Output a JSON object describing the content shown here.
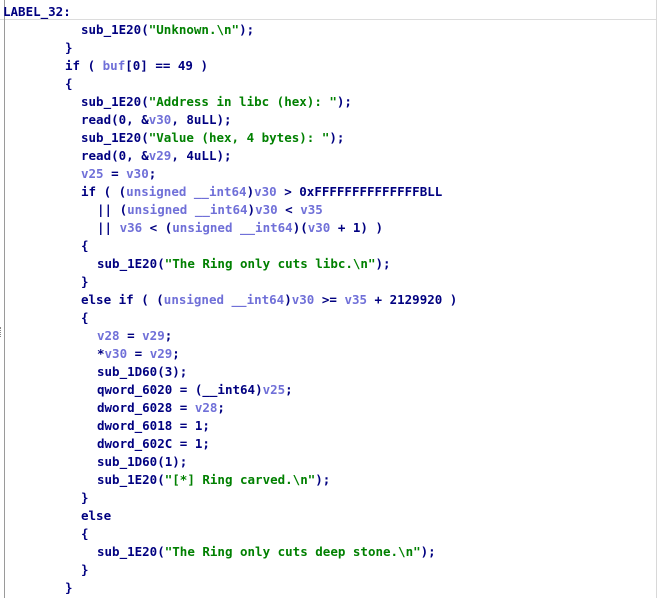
{
  "code": {
    "lines": [
      {
        "indent": 0,
        "tokens": [
          {
            "t": "LABEL_32:",
            "c": "label"
          }
        ]
      },
      {
        "indent": 2,
        "tokens": [
          {
            "t": "sub_1E20",
            "c": "func"
          },
          {
            "t": "(",
            "c": "punct"
          },
          {
            "t": "\"Unknown.\\n\"",
            "c": "str"
          },
          {
            "t": ");",
            "c": "punct"
          }
        ]
      },
      {
        "indent": 1,
        "tokens": [
          {
            "t": "}",
            "c": "punct"
          }
        ]
      },
      {
        "indent": 1,
        "tokens": [
          {
            "t": "if",
            "c": "kw"
          },
          {
            "t": " ( ",
            "c": "punct"
          },
          {
            "t": "buf",
            "c": "var"
          },
          {
            "t": "[0] == 49 )",
            "c": "punct"
          }
        ]
      },
      {
        "indent": 1,
        "tokens": [
          {
            "t": "{",
            "c": "punct"
          }
        ]
      },
      {
        "indent": 2,
        "tokens": [
          {
            "t": "sub_1E20",
            "c": "func"
          },
          {
            "t": "(",
            "c": "punct"
          },
          {
            "t": "\"Address in libc (hex): \"",
            "c": "str"
          },
          {
            "t": ");",
            "c": "punct"
          }
        ]
      },
      {
        "indent": 2,
        "tokens": [
          {
            "t": "read",
            "c": "func"
          },
          {
            "t": "(0, &",
            "c": "punct"
          },
          {
            "t": "v30",
            "c": "var"
          },
          {
            "t": ", 8uLL);",
            "c": "punct"
          }
        ]
      },
      {
        "indent": 2,
        "tokens": [
          {
            "t": "sub_1E20",
            "c": "func"
          },
          {
            "t": "(",
            "c": "punct"
          },
          {
            "t": "\"Value (hex, 4 bytes): \"",
            "c": "str"
          },
          {
            "t": ");",
            "c": "punct"
          }
        ]
      },
      {
        "indent": 2,
        "tokens": [
          {
            "t": "read",
            "c": "func"
          },
          {
            "t": "(0, &",
            "c": "punct"
          },
          {
            "t": "v29",
            "c": "var"
          },
          {
            "t": ", 4uLL);",
            "c": "punct"
          }
        ]
      },
      {
        "indent": 2,
        "tokens": [
          {
            "t": "v25",
            "c": "var"
          },
          {
            "t": " = ",
            "c": "punct"
          },
          {
            "t": "v30",
            "c": "var"
          },
          {
            "t": ";",
            "c": "punct"
          }
        ]
      },
      {
        "indent": 2,
        "tokens": [
          {
            "t": "if",
            "c": "kw"
          },
          {
            "t": " ( (",
            "c": "punct"
          },
          {
            "t": "unsigned __int64",
            "c": "type"
          },
          {
            "t": ")",
            "c": "punct"
          },
          {
            "t": "v30",
            "c": "var"
          },
          {
            "t": " > 0xFFFFFFFFFFFFFFBLL",
            "c": "punct"
          }
        ]
      },
      {
        "indent": 3,
        "tokens": [
          {
            "t": "|| (",
            "c": "punct"
          },
          {
            "t": "unsigned __int64",
            "c": "type"
          },
          {
            "t": ")",
            "c": "punct"
          },
          {
            "t": "v30",
            "c": "var"
          },
          {
            "t": " < ",
            "c": "punct"
          },
          {
            "t": "v35",
            "c": "var"
          }
        ]
      },
      {
        "indent": 3,
        "tokens": [
          {
            "t": "|| ",
            "c": "punct"
          },
          {
            "t": "v36",
            "c": "var"
          },
          {
            "t": " < (",
            "c": "punct"
          },
          {
            "t": "unsigned __int64",
            "c": "type"
          },
          {
            "t": ")(",
            "c": "punct"
          },
          {
            "t": "v30",
            "c": "var"
          },
          {
            "t": " + 1) )",
            "c": "punct"
          }
        ]
      },
      {
        "indent": 2,
        "tokens": [
          {
            "t": "{",
            "c": "punct"
          }
        ]
      },
      {
        "indent": 3,
        "tokens": [
          {
            "t": "sub_1E20",
            "c": "func"
          },
          {
            "t": "(",
            "c": "punct"
          },
          {
            "t": "\"The Ring only cuts libc.\\n\"",
            "c": "str"
          },
          {
            "t": ");",
            "c": "punct"
          }
        ]
      },
      {
        "indent": 2,
        "tokens": [
          {
            "t": "}",
            "c": "punct"
          }
        ]
      },
      {
        "indent": 2,
        "tokens": [
          {
            "t": "else if",
            "c": "kw"
          },
          {
            "t": " ( (",
            "c": "punct"
          },
          {
            "t": "unsigned __int64",
            "c": "type"
          },
          {
            "t": ")",
            "c": "punct"
          },
          {
            "t": "v30",
            "c": "var"
          },
          {
            "t": " >= ",
            "c": "punct"
          },
          {
            "t": "v35",
            "c": "var"
          },
          {
            "t": " + 2129920 )",
            "c": "punct"
          }
        ]
      },
      {
        "indent": 2,
        "tokens": [
          {
            "t": "{",
            "c": "punct"
          }
        ]
      },
      {
        "indent": 3,
        "tokens": [
          {
            "t": "v28",
            "c": "var"
          },
          {
            "t": " = ",
            "c": "punct"
          },
          {
            "t": "v29",
            "c": "var"
          },
          {
            "t": ";",
            "c": "punct"
          }
        ]
      },
      {
        "indent": 3,
        "tokens": [
          {
            "t": "*",
            "c": "punct"
          },
          {
            "t": "v30",
            "c": "var"
          },
          {
            "t": " = ",
            "c": "punct"
          },
          {
            "t": "v29",
            "c": "var"
          },
          {
            "t": ";",
            "c": "punct"
          }
        ]
      },
      {
        "indent": 3,
        "tokens": [
          {
            "t": "sub_1D60",
            "c": "func"
          },
          {
            "t": "(3);",
            "c": "punct"
          }
        ]
      },
      {
        "indent": 3,
        "tokens": [
          {
            "t": "qword_6020",
            "c": "func"
          },
          {
            "t": " = (",
            "c": "punct"
          },
          {
            "t": "__int64",
            "c": "punct"
          },
          {
            "t": ")",
            "c": "punct"
          },
          {
            "t": "v25",
            "c": "var"
          },
          {
            "t": ";",
            "c": "punct"
          }
        ]
      },
      {
        "indent": 3,
        "tokens": [
          {
            "t": "dword_6028",
            "c": "func"
          },
          {
            "t": " = ",
            "c": "punct"
          },
          {
            "t": "v28",
            "c": "var"
          },
          {
            "t": ";",
            "c": "punct"
          }
        ]
      },
      {
        "indent": 3,
        "tokens": [
          {
            "t": "dword_6018",
            "c": "func"
          },
          {
            "t": " = 1;",
            "c": "punct"
          }
        ]
      },
      {
        "indent": 3,
        "tokens": [
          {
            "t": "dword_602C",
            "c": "func"
          },
          {
            "t": " = 1;",
            "c": "punct"
          }
        ]
      },
      {
        "indent": 3,
        "tokens": [
          {
            "t": "sub_1D60",
            "c": "func"
          },
          {
            "t": "(1);",
            "c": "punct"
          }
        ]
      },
      {
        "indent": 3,
        "tokens": [
          {
            "t": "sub_1E20",
            "c": "func"
          },
          {
            "t": "(",
            "c": "punct"
          },
          {
            "t": "\"[*] Ring carved.\\n\"",
            "c": "str"
          },
          {
            "t": ");",
            "c": "punct"
          }
        ]
      },
      {
        "indent": 2,
        "tokens": [
          {
            "t": "}",
            "c": "punct"
          }
        ]
      },
      {
        "indent": 2,
        "tokens": [
          {
            "t": "else",
            "c": "kw"
          }
        ]
      },
      {
        "indent": 2,
        "tokens": [
          {
            "t": "{",
            "c": "punct"
          }
        ]
      },
      {
        "indent": 3,
        "tokens": [
          {
            "t": "sub_1E20",
            "c": "func"
          },
          {
            "t": "(",
            "c": "punct"
          },
          {
            "t": "\"The Ring only cuts deep stone.\\n\"",
            "c": "str"
          },
          {
            "t": ");",
            "c": "punct"
          }
        ]
      },
      {
        "indent": 2,
        "tokens": [
          {
            "t": "}",
            "c": "punct"
          }
        ]
      },
      {
        "indent": 1,
        "tokens": [
          {
            "t": "}",
            "c": "punct"
          }
        ]
      }
    ]
  },
  "colors": {
    "keyword": "#000080",
    "string": "#008000",
    "variable": "#7070d8",
    "background": "#ffffff"
  }
}
